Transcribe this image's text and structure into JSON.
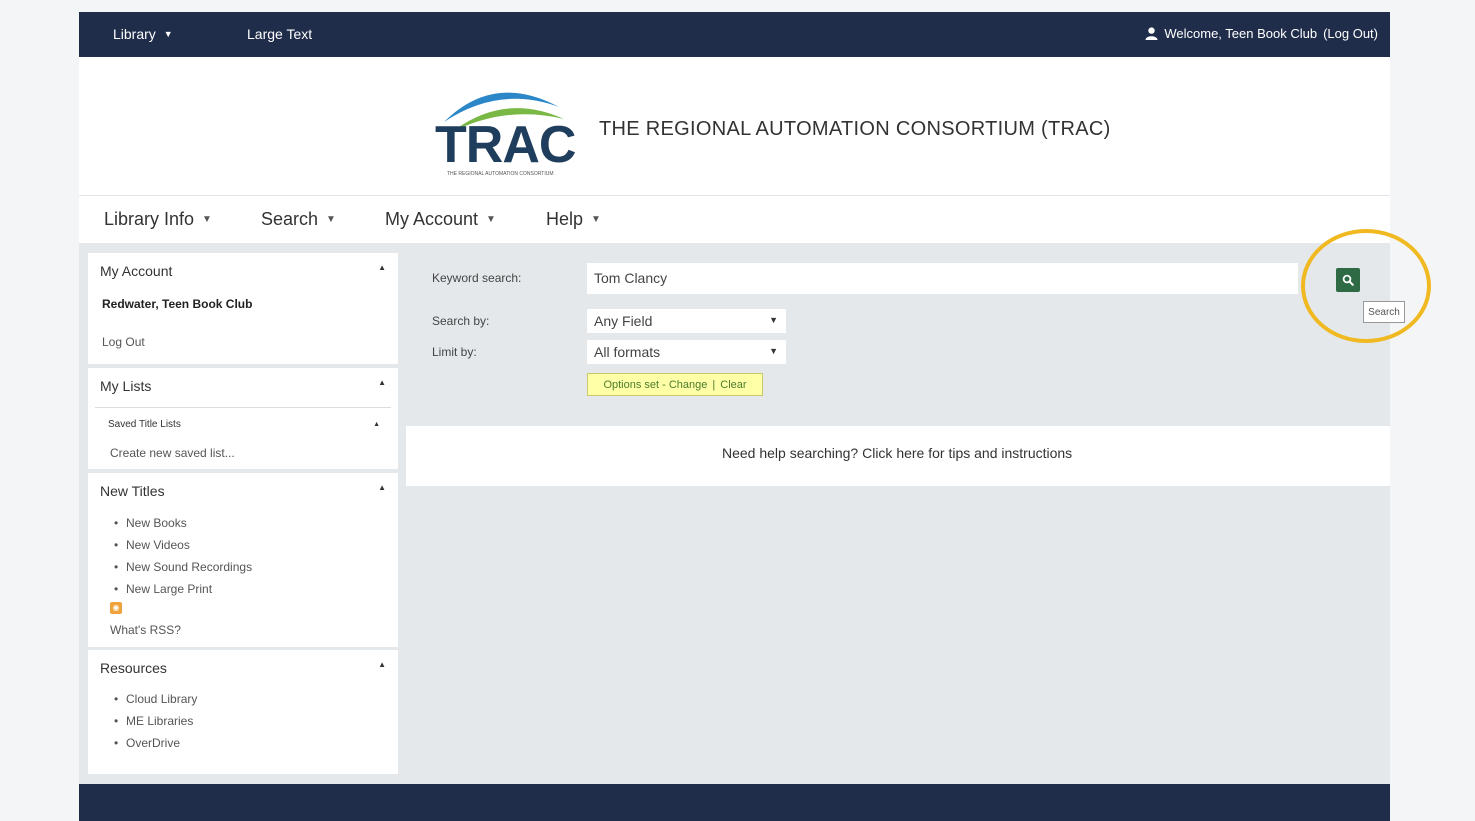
{
  "topbar": {
    "library_label": "Library",
    "large_text_label": "Large Text",
    "welcome_text": "Welcome, Teen Book Club",
    "logout_link": "(Log Out)"
  },
  "header": {
    "logo_text": "TRAC",
    "logo_subtext": "THE REGIONAL AUTOMATION CONSORTIUM",
    "site_title": "THE REGIONAL AUTOMATION CONSORTIUM (TRAC)"
  },
  "nav": {
    "items": [
      {
        "label": "Library Info"
      },
      {
        "label": "Search"
      },
      {
        "label": "My Account"
      },
      {
        "label": "Help"
      }
    ]
  },
  "sidebar": {
    "my_account": {
      "title": "My Account",
      "user": "Redwater, Teen Book Club",
      "logout": "Log Out"
    },
    "my_lists": {
      "title": "My Lists",
      "saved_title_lists": "Saved Title Lists",
      "create_new": "Create new saved list..."
    },
    "new_titles": {
      "title": "New Titles",
      "items": [
        "New Books",
        "New Videos",
        "New Sound Recordings",
        "New Large Print"
      ],
      "rss_label": "What's RSS?"
    },
    "resources": {
      "title": "Resources",
      "items": [
        "Cloud Library",
        "ME Libraries",
        "OverDrive"
      ]
    }
  },
  "search": {
    "keyword_label": "Keyword search:",
    "keyword_value": "Tom Clancy",
    "search_by_label": "Search by:",
    "search_by_value": "Any Field",
    "limit_by_label": "Limit by:",
    "limit_by_value": "All formats",
    "options_set": "Options set - Change",
    "separator": "|",
    "clear": "Clear",
    "tooltip": "Search",
    "help_text": "Need help searching? Click here for tips and instructions"
  },
  "colors": {
    "navy": "#1f2d4a",
    "search_button": "#2e6b45",
    "highlight_ring": "#f0b921",
    "options_bg": "#ffffa8"
  }
}
